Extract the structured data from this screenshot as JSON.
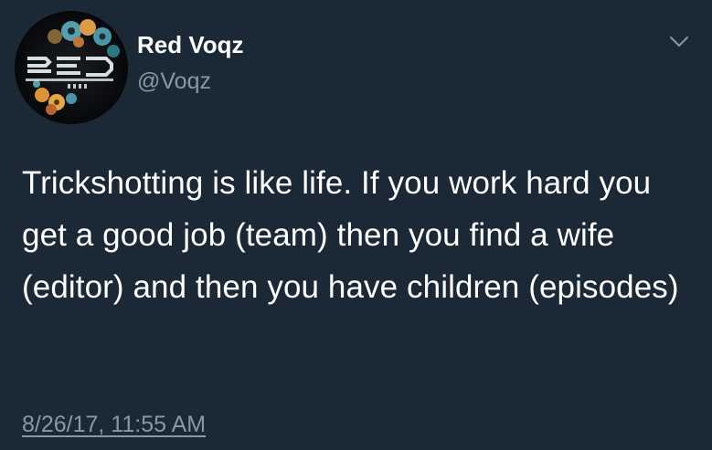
{
  "author": {
    "display_name": "Red Voqz",
    "handle": "@Voqz",
    "avatar_icon": "red-voqz-logo-avatar",
    "avatar_lettering": "RED VOQZ"
  },
  "tweet": {
    "text": "Trickshotting is like life. If you work hard you get a good job (team) then you find a wife (editor) and then you have children (episodes)",
    "timestamp": "8/26/17, 11:55 AM"
  },
  "controls": {
    "menu_icon": "chevron-down-icon"
  },
  "colors": {
    "background": "#1b2836",
    "primary_text": "#ffffff",
    "secondary_text": "#8899a6"
  }
}
